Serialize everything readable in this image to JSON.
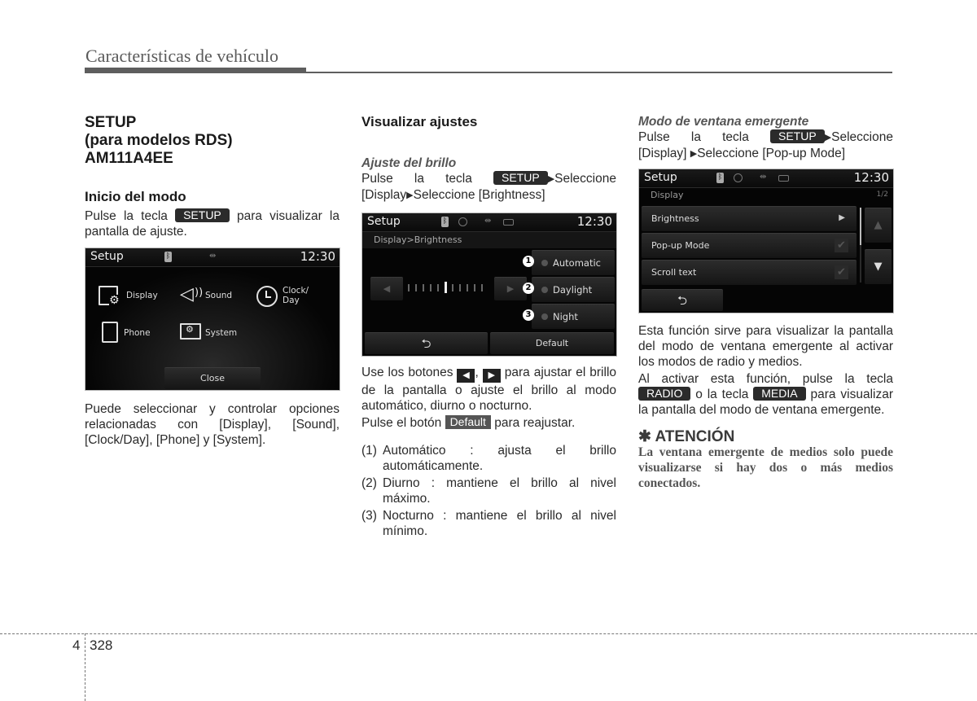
{
  "header": {
    "section_title": "Características de vehículo"
  },
  "col1": {
    "title_lines": [
      "SETUP",
      "(para modelos RDS)",
      "AM111A4EE"
    ],
    "heading": "Inicio del modo",
    "intro_pre": "Pulse la tecla",
    "intro_key": "SETUP",
    "intro_post": "para visualizar la pantalla de ajuste.",
    "screen": {
      "title": "Setup",
      "time": "12:30",
      "menu": [
        {
          "label": "Display",
          "icon": "display-gear-icon"
        },
        {
          "label": "Sound",
          "icon": "speaker-icon"
        },
        {
          "label_line1": "Clock/",
          "label_line2": "Day",
          "icon": "clock-icon"
        },
        {
          "label": "Phone",
          "icon": "phone-icon"
        },
        {
          "label": "System",
          "icon": "folder-gear-icon"
        }
      ],
      "close_label": "Close"
    },
    "body": "Puede seleccionar y controlar opciones relacionadas con [Display], [Sound], [Clock/Day], [Phone] y [System]."
  },
  "col2": {
    "heading": "Visualizar ajustes",
    "subheading": "Ajuste del brillo",
    "step_pre": "Pulse la tecla",
    "step_key": "SETUP",
    "step_post1": "Seleccione",
    "step_line2_a": "[Display",
    "step_line2_b": "Seleccione [Brightness]",
    "screen": {
      "title": "Setup",
      "time": "12:30",
      "breadcrumb": "Display>Brightness",
      "options": [
        {
          "num": "1",
          "label": "Automatic"
        },
        {
          "num": "2",
          "label": "Daylight"
        },
        {
          "num": "3",
          "label": "Night"
        }
      ],
      "brightness_level": 6,
      "brightness_steps": 11,
      "default_label": "Default"
    },
    "use_text_pre": "Use los botones",
    "use_text_mid": ",",
    "use_text_post": "para ajustar el brillo de la pantalla o ajuste el brillo al modo automático, diurno o nocturno.",
    "reset_pre": "Pulse el botón",
    "reset_key": "Default",
    "reset_post": "para reajustar.",
    "list": [
      {
        "num": "(1)",
        "text": "Automático : ajusta el brillo automáticamente."
      },
      {
        "num": "(2)",
        "text": "Diurno : mantiene el brillo al nivel máximo."
      },
      {
        "num": "(3)",
        "text": "Nocturno : mantiene el brillo al nivel mínimo."
      }
    ]
  },
  "col3": {
    "subheading": "Modo de ventana emergente",
    "step_pre": "Pulse la tecla",
    "step_key": "SETUP",
    "step_post1": "Seleccione",
    "step_line2_a": "[Display]",
    "step_line2_b": "Seleccione [Pop-up Mode]",
    "screen": {
      "title": "Setup",
      "time": "12:30",
      "section": "Display",
      "page": "1/2",
      "items": [
        {
          "label": "Brightness",
          "control": "arrow"
        },
        {
          "label": "Pop-up Mode",
          "control": "checkbox",
          "checked": true
        },
        {
          "label": "Scroll text",
          "control": "checkbox",
          "checked": true
        }
      ]
    },
    "body1": "Esta función sirve para visualizar la pantalla del modo de ventana emergente al activar los modos de radio y medios.",
    "body2_pre": "Al activar esta función, pulse la tecla",
    "key_radio": "RADIO",
    "body2_mid": "o la tecla",
    "key_media": "MEDIA",
    "body2_post": "para visualizar la pantalla del modo de ventana emergente.",
    "attention_title": "✱ ATENCIÓN",
    "attention_body": "La ventana emergente de medios solo puede visualizarse si hay dos o más medios conectados."
  },
  "footer": {
    "chapter": "4",
    "page": "328"
  }
}
